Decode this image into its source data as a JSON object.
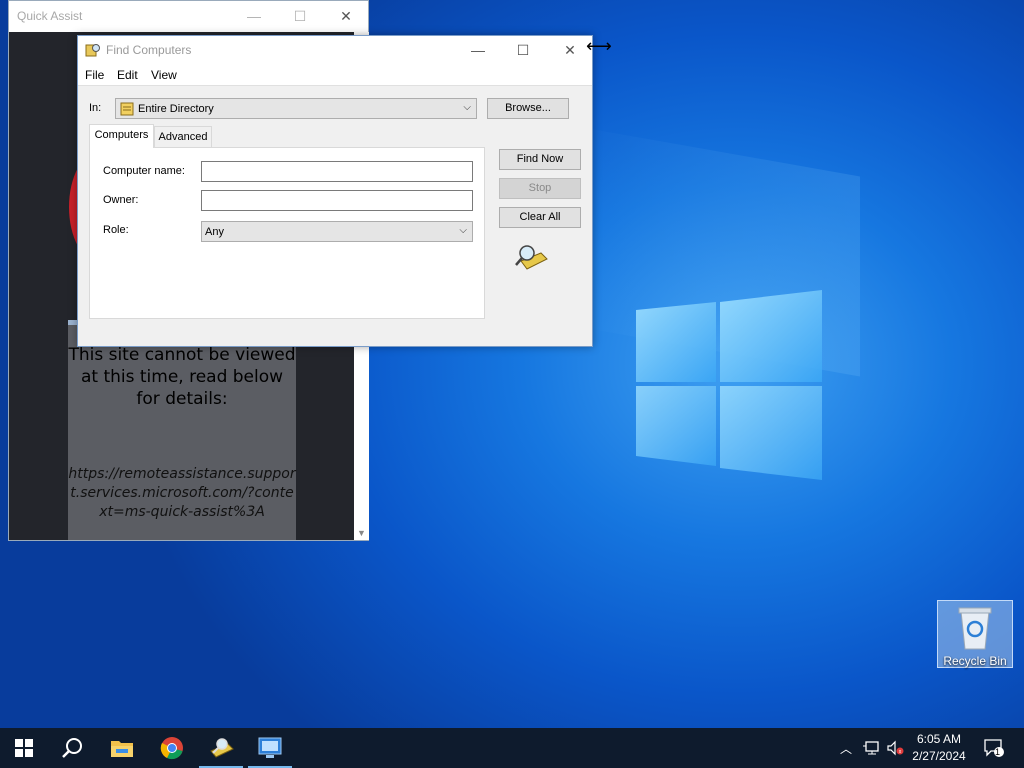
{
  "desktop": {
    "recycle_bin_label": "Recycle Bin"
  },
  "quick_assist": {
    "title": "Quick Assist",
    "message": "This site cannot be viewed at this time, read below for details:",
    "url": "https://remoteassistance.support.services.microsoft.com/?context=ms-quick-assist%3A"
  },
  "find_computers": {
    "title": "Find Computers",
    "menu": [
      "File",
      "Edit",
      "View"
    ],
    "in_label": "In:",
    "in_value": "Entire Directory",
    "browse_label": "Browse...",
    "tabs": [
      "Computers",
      "Advanced"
    ],
    "computer_name_label": "Computer name:",
    "computer_name_value": "",
    "owner_label": "Owner:",
    "owner_value": "",
    "role_label": "Role:",
    "role_value": "Any",
    "find_now_label": "Find Now",
    "stop_label": "Stop",
    "clear_all_label": "Clear All"
  },
  "taskbar": {
    "items": [
      "start-icon",
      "search-icon",
      "file-explorer-icon",
      "chrome-icon",
      "find-computers-icon",
      "remote-desktop-icon"
    ],
    "time": "6:05 AM",
    "date": "2/27/2024",
    "notification_count": "1"
  },
  "colors": {
    "desktop_blue": "#0b63d6",
    "taskbar": "#0e1b2d",
    "accent": "#76b9ed"
  }
}
